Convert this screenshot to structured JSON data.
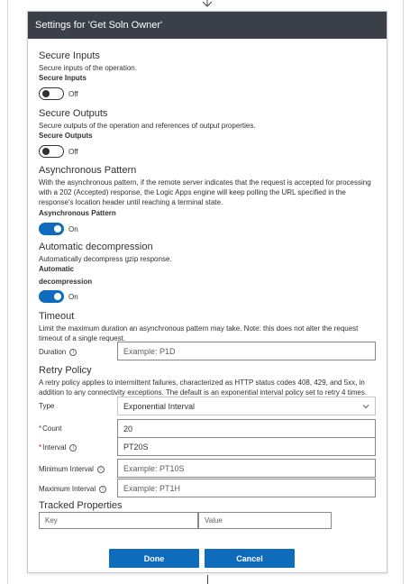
{
  "panel": {
    "title": "Settings for 'Get Soln Owner'"
  },
  "secure_inputs": {
    "title": "Secure Inputs",
    "description": "Secure inputs of the operation.",
    "label": "Secure Inputs",
    "state": "Off"
  },
  "secure_outputs": {
    "title": "Secure Outputs",
    "description": "Secure outputs of the operation and references of output properties.",
    "label": "Secure Outputs",
    "state": "Off"
  },
  "async_pattern": {
    "title": "Asynchronous Pattern",
    "description": "With the asynchronous pattern, if the remote server indicates that the request is accepted for processing with a 202 (Accepted) response, the Logic Apps engine will keep polling the URL specified in the response's location header until reaching a terminal state.",
    "label": "Asynchronous Pattern",
    "state": "On"
  },
  "decompression": {
    "title": "Automatic decompression",
    "description": "Automatically decompress gzip response.",
    "label_line1": "Automatic",
    "label_line2": "decompression",
    "state": "On"
  },
  "timeout": {
    "title": "Timeout",
    "description": "Limit the maximum duration an asynchronous pattern may take. Note: this does not alter the request timeout of a single request.",
    "duration_label": "Duration",
    "duration_placeholder": "Example: P1D"
  },
  "retry_policy": {
    "title": "Retry Policy",
    "description": "A retry policy applies to intermittent failures, characterized as HTTP status codes 408, 429, and 5xx, in addition to any connectivity exceptions. The default is an exponential interval policy set to retry 4 times.",
    "type_label": "Type",
    "type_value": "Exponential Interval",
    "count_label": "Count",
    "count_value": "20",
    "interval_label": "Interval",
    "interval_value": "PT20S",
    "min_interval_label": "Minimum Interval",
    "min_interval_placeholder": "Example: PT10S",
    "max_interval_label": "Maximum Interval",
    "max_interval_placeholder": "Example: PT1H"
  },
  "tracked_properties": {
    "title": "Tracked Properties",
    "key_placeholder": "Key",
    "value_placeholder": "Value"
  },
  "buttons": {
    "done": "Done",
    "cancel": "Cancel"
  },
  "icons": {
    "info": "info-icon",
    "chevron": "chevron-down-icon",
    "arrow": "arrow-down-icon"
  },
  "colors": {
    "header_bg": "#3b3f47",
    "accent": "#0f6cbd",
    "required": "#a4262c"
  }
}
